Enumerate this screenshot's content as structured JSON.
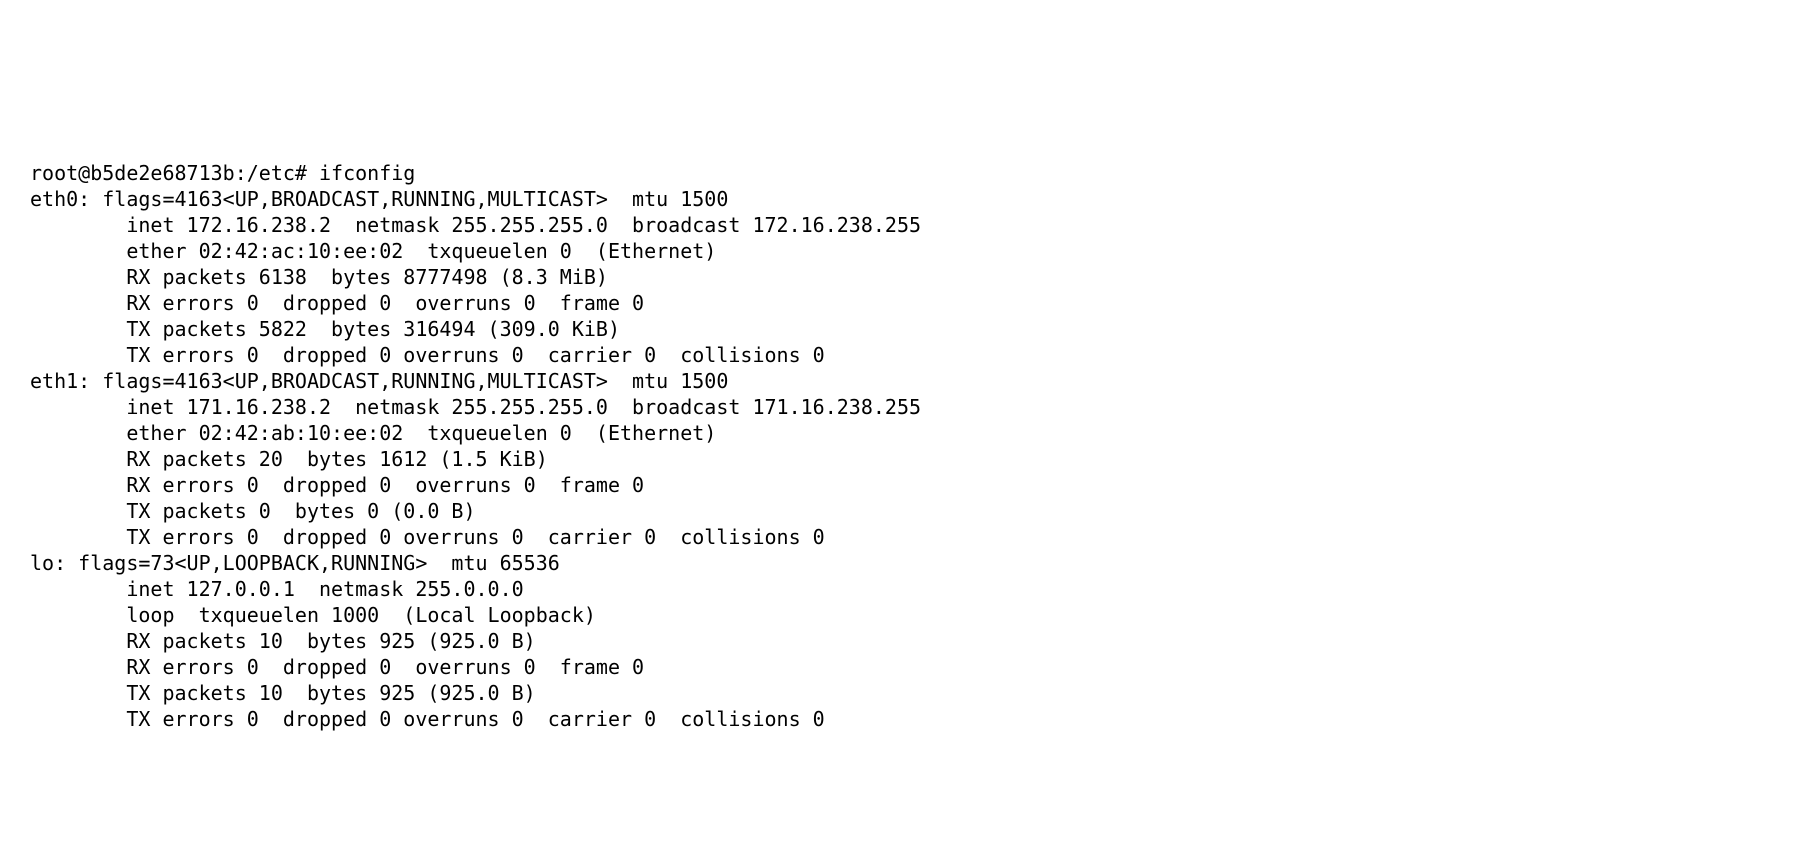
{
  "prompt": {
    "user": "root",
    "host": "b5de2e68713b",
    "cwd": "/etc",
    "symbol": "#",
    "command": "ifconfig"
  },
  "interfaces": [
    {
      "name": "eth0",
      "flags_num": "4163",
      "flags_list": "UP,BROADCAST,RUNNING,MULTICAST",
      "mtu": "1500",
      "inet": "172.16.238.2",
      "netmask": "255.255.255.0",
      "broadcast": "172.16.238.255",
      "link_type": "ether",
      "link_addr": "02:42:ac:10:ee:02",
      "txqueuelen": "0",
      "link_label": "Ethernet",
      "rx_packets": "6138",
      "rx_bytes": "8777498",
      "rx_bytes_human": "8.3 MiB",
      "rx_errors": "0",
      "rx_dropped": "0",
      "rx_overruns": "0",
      "rx_frame": "0",
      "tx_packets": "5822",
      "tx_bytes": "316494",
      "tx_bytes_human": "309.0 KiB",
      "tx_errors": "0",
      "tx_dropped": "0",
      "tx_overruns": "0",
      "tx_carrier": "0",
      "tx_collisions": "0"
    },
    {
      "name": "eth1",
      "flags_num": "4163",
      "flags_list": "UP,BROADCAST,RUNNING,MULTICAST",
      "mtu": "1500",
      "inet": "171.16.238.2",
      "netmask": "255.255.255.0",
      "broadcast": "171.16.238.255",
      "link_type": "ether",
      "link_addr": "02:42:ab:10:ee:02",
      "txqueuelen": "0",
      "link_label": "Ethernet",
      "rx_packets": "20",
      "rx_bytes": "1612",
      "rx_bytes_human": "1.5 KiB",
      "rx_errors": "0",
      "rx_dropped": "0",
      "rx_overruns": "0",
      "rx_frame": "0",
      "tx_packets": "0",
      "tx_bytes": "0",
      "tx_bytes_human": "0.0 B",
      "tx_errors": "0",
      "tx_dropped": "0",
      "tx_overruns": "0",
      "tx_carrier": "0",
      "tx_collisions": "0"
    },
    {
      "name": "lo",
      "flags_num": "73",
      "flags_list": "UP,LOOPBACK,RUNNING",
      "mtu": "65536",
      "inet": "127.0.0.1",
      "netmask": "255.0.0.0",
      "broadcast": null,
      "link_type": "loop",
      "link_addr": null,
      "txqueuelen": "1000",
      "link_label": "Local Loopback",
      "rx_packets": "10",
      "rx_bytes": "925",
      "rx_bytes_human": "925.0 B",
      "rx_errors": "0",
      "rx_dropped": "0",
      "rx_overruns": "0",
      "rx_frame": "0",
      "tx_packets": "10",
      "tx_bytes": "925",
      "tx_bytes_human": "925.0 B",
      "tx_errors": "0",
      "tx_dropped": "0",
      "tx_overruns": "0",
      "tx_carrier": "0",
      "tx_collisions": "0"
    }
  ]
}
